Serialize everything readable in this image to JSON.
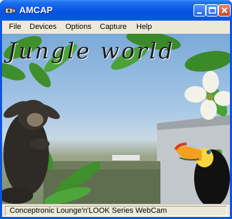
{
  "window": {
    "title": "AMCAP"
  },
  "menu": {
    "items": [
      "File",
      "Devices",
      "Options",
      "Capture",
      "Help"
    ]
  },
  "video": {
    "overlay_title": "Jungle world"
  },
  "status": {
    "text": "Conceptronic Lounge'n'LOOK Series WebCam"
  },
  "colors": {
    "titlebar": "#0a54e3",
    "menubar": "#ece9d8",
    "fern": "#3f8f2c",
    "sky": "#a8c8e6"
  }
}
